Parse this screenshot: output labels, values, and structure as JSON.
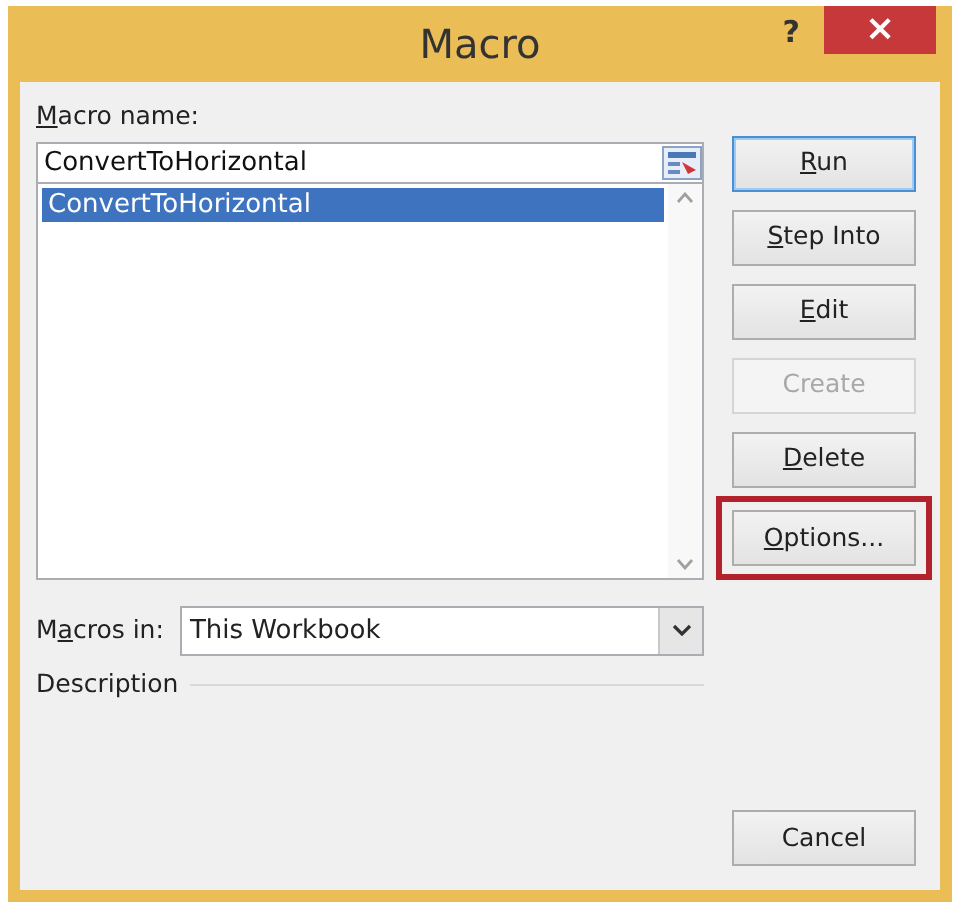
{
  "window": {
    "title": "Macro"
  },
  "title_buttons": [
    {
      "kind": "help",
      "label": "?"
    },
    {
      "kind": "close",
      "label": "×"
    }
  ],
  "macro_name": {
    "access_key": "M",
    "label_rest": "acro name:",
    "value": "ConvertToHorizontal"
  },
  "macros": [
    {
      "name": "ConvertToHorizontal",
      "selected": true
    }
  ],
  "buttons": [
    {
      "access_key": "R",
      "label_rest": "un",
      "disabled": false,
      "default": true,
      "highlighted": false
    },
    {
      "access_key": "S",
      "label_rest": "tep Into",
      "disabled": false,
      "default": false,
      "highlighted": false
    },
    {
      "access_key": "E",
      "label_rest": "dit",
      "disabled": false,
      "default": false,
      "highlighted": false
    },
    {
      "label_rest": "Create",
      "disabled": true,
      "default": false,
      "highlighted": false
    },
    {
      "access_key": "D",
      "label_rest": "elete",
      "disabled": false,
      "default": false,
      "highlighted": false
    },
    {
      "access_key": "O",
      "label_rest": "ptions...",
      "disabled": false,
      "default": false,
      "highlighted": true
    }
  ],
  "macros_in": {
    "label_start": "M",
    "access_key": "a",
    "label_rest": "cros in:",
    "value": "This Workbook"
  },
  "description": {
    "label": "Description"
  },
  "cancel": {
    "label": "Cancel"
  }
}
